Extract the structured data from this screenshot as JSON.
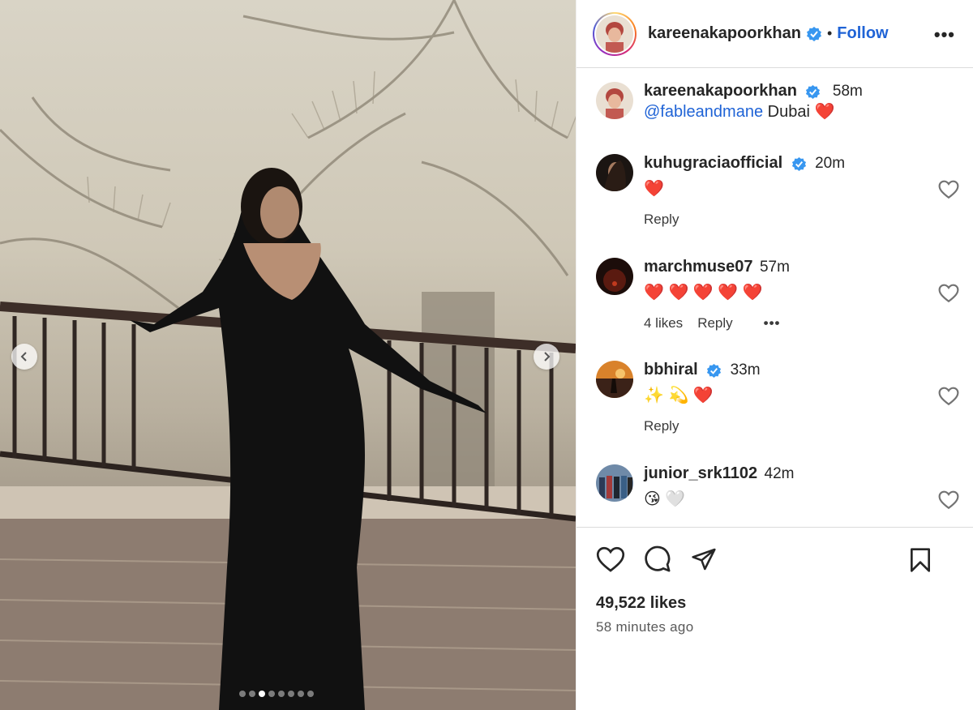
{
  "post": {
    "author": "kareenakapoorkhan",
    "follow_label": "Follow",
    "separator": "•",
    "more_label": "•••",
    "photo_index": 3,
    "photo_count": 8
  },
  "caption": {
    "user": "kareenakapoorkhan",
    "time": "58m",
    "mention": "@fableandmane",
    "text": " Dubai ❤️"
  },
  "comments": [
    {
      "user": "kuhugraciaofficial",
      "verified": true,
      "time": "20m",
      "text": "❤️",
      "likes": "",
      "reply": "Reply"
    },
    {
      "user": "marchmuse07",
      "verified": false,
      "time": "57m",
      "text": "❤️ ❤️ ❤️ ❤️ ❤️",
      "likes": "4 likes",
      "reply": "Reply",
      "more": "•••"
    },
    {
      "user": "bbhiral",
      "verified": true,
      "time": "33m",
      "text": "✨ 💫 ❤️",
      "likes": "",
      "reply": "Reply"
    },
    {
      "user": "junior_srk1102",
      "verified": false,
      "time": "42m",
      "text": "😘 🤍",
      "likes": "",
      "reply": ""
    }
  ],
  "stats": {
    "likes": "49,522 likes",
    "time_ago": "58 minutes ago"
  },
  "icons": {
    "like": "heart-icon",
    "comment": "comment-icon",
    "share": "share-icon",
    "save": "bookmark-icon",
    "verified": "verified-badge-icon"
  },
  "colors": {
    "accent": "#1f63d6",
    "verified": "#3897f0",
    "heart": "#ed1f49"
  }
}
